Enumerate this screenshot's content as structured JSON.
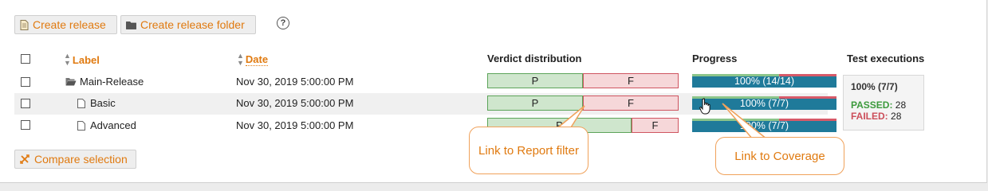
{
  "toolbar": {
    "create_release_label": "Create release",
    "create_release_folder_label": "Create release folder",
    "help_icon_text": "?"
  },
  "table": {
    "headers": {
      "label": "Label",
      "date": "Date",
      "verdict": "Verdict distribution",
      "progress": "Progress",
      "test_executions": "Test executions"
    },
    "rows": [
      {
        "label": "Main-Release",
        "date": "Nov 30, 2019 5:00:00 PM",
        "pass": "P",
        "fail": "F",
        "progress_text": "100% (14/14)"
      },
      {
        "label": "Basic",
        "date": "Nov 30, 2019 5:00:00 PM",
        "pass": "P",
        "fail": "F",
        "progress_text": "100% (7/7)"
      },
      {
        "label": "Advanced",
        "date": "Nov 30, 2019 5:00:00 PM",
        "pass": "P",
        "fail": "F",
        "progress_text": "100% (7/7)"
      }
    ]
  },
  "tooltip": {
    "title": "100% (7/7)",
    "passed_label": "PASSED:",
    "passed_value": "28",
    "failed_label": "FAILED:",
    "failed_value": "28"
  },
  "compare_label": "Compare selection",
  "callouts": {
    "report_filter": "Link to Report filter",
    "coverage": "Link to Coverage"
  },
  "colors": {
    "accent": "#e07a10",
    "progress": "#1f7a9a",
    "pass_fill": "#cfe6cd",
    "fail_fill": "#f6d7d9",
    "callout_border": "#f0a15a"
  },
  "icons": {
    "create_release": "document-icon",
    "create_folder": "folder-icon",
    "help": "help-icon",
    "sort": "sort-icon",
    "folder_open": "folder-open-icon",
    "document": "document-icon",
    "compare": "compare-icon",
    "cursor": "hand-cursor-icon"
  }
}
